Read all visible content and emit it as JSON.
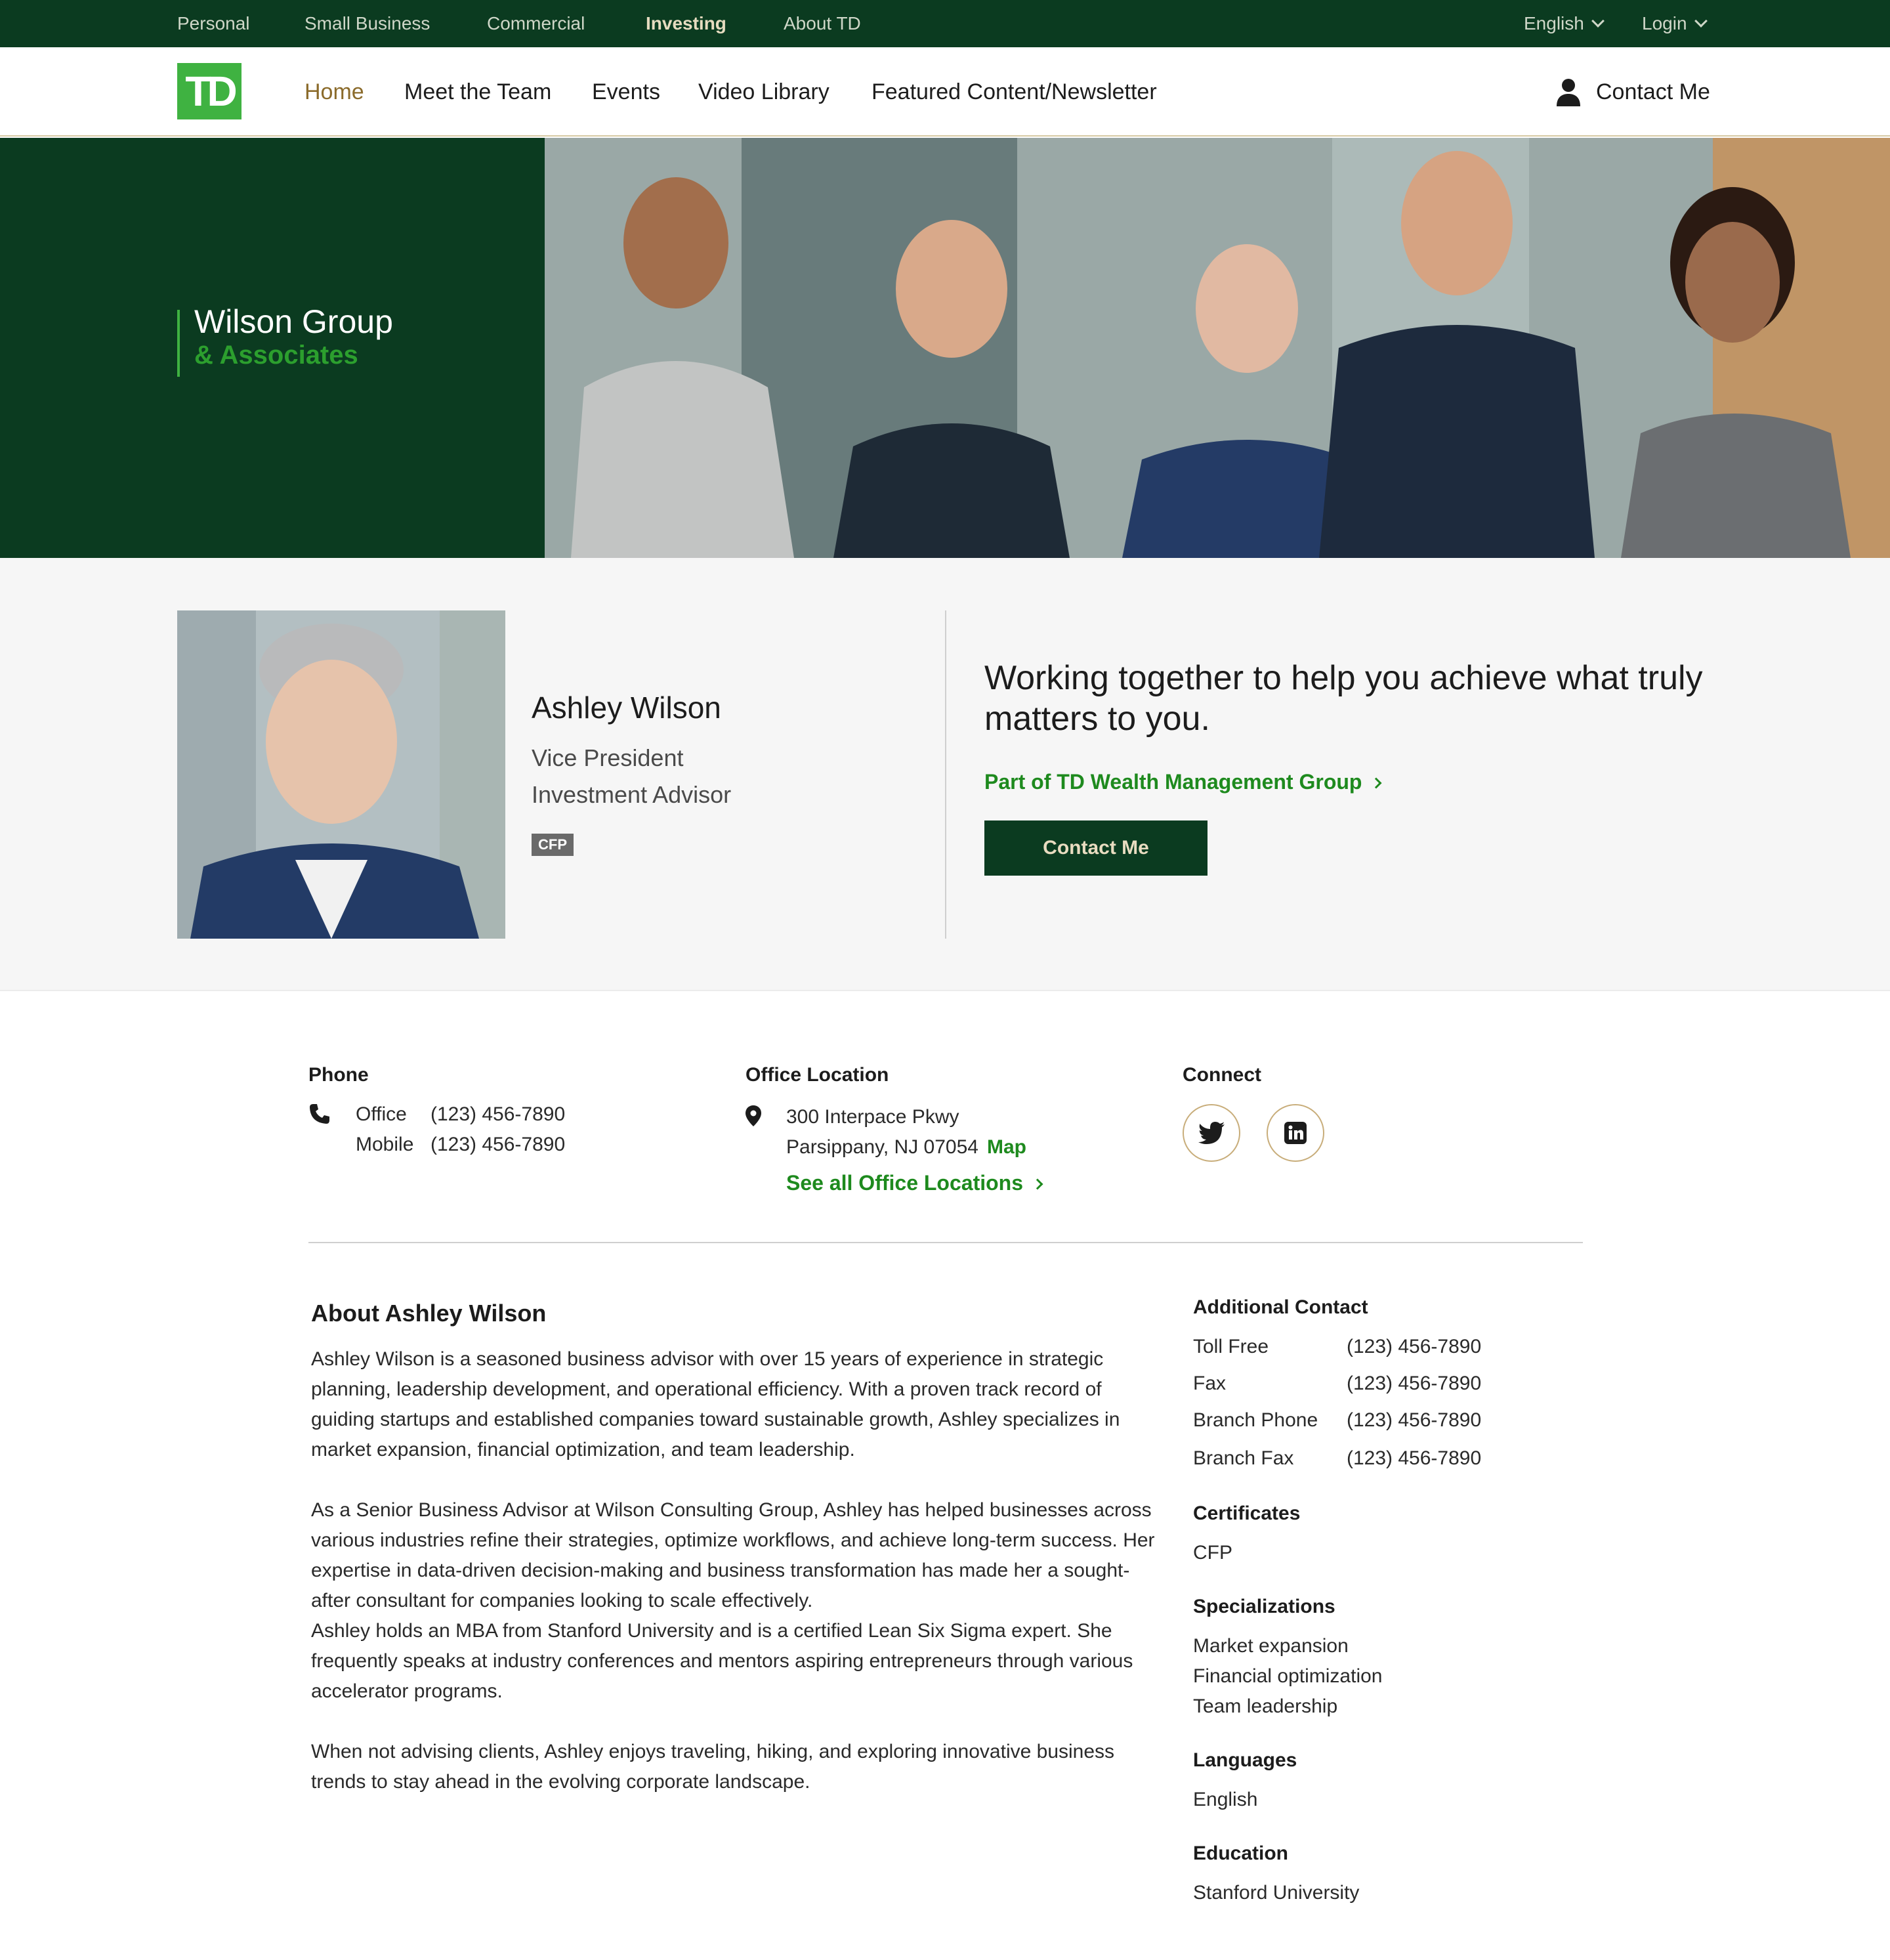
{
  "topbar": {
    "links": [
      "Personal",
      "Small Business",
      "Commercial",
      "Investing",
      "About TD"
    ],
    "active": "Investing",
    "language": "English",
    "login": "Login"
  },
  "nav": {
    "logo_text": "TD",
    "items": [
      "Home",
      "Meet the Team",
      "Events",
      "Video Library",
      "Featured Content/Newsletter"
    ],
    "active": "Home",
    "contact": "Contact Me"
  },
  "hero": {
    "title": "Wilson Group",
    "subtitle": "& Associates"
  },
  "profile": {
    "name": "Ashley Wilson",
    "title1": "Vice President",
    "title2": "Investment Advisor",
    "badge": "CFP",
    "tagline": "Working together to help you achieve what truly matters to you.",
    "group_link": "Part of TD Wealth Management Group",
    "contact_button": "Contact Me"
  },
  "phone": {
    "heading": "Phone",
    "office_label": "Office",
    "office": "(123) 456-7890",
    "mobile_label": "Mobile",
    "mobile": "(123) 456-7890"
  },
  "office": {
    "heading": "Office Location",
    "address1": "300 Interpace Pkwy",
    "address2": "Parsippany, NJ 07054",
    "map_link": "Map",
    "all_locations": "See all Office Locations"
  },
  "connect": {
    "heading": "Connect"
  },
  "about": {
    "title": "About Ashley Wilson",
    "p1": "Ashley Wilson is a seasoned business advisor with over 15 years of experience in strategic planning, leadership development, and operational efficiency. With a proven track record of guiding startups and established companies toward sustainable growth, Ashley specializes in market expansion, financial optimization, and team leadership.",
    "p2": "As a Senior Business Advisor at Wilson Consulting Group, Ashley has helped businesses across various industries refine their strategies, optimize workflows, and achieve long-term success. Her expertise in data-driven decision-making and business transformation has made her a sought-after consultant for companies looking to scale effectively.",
    "p3": "Ashley holds an MBA from Stanford University and is a certified Lean Six Sigma expert. She frequently speaks at industry conferences and mentors aspiring entrepreneurs through various accelerator programs.",
    "p4": "When not advising clients, Ashley enjoys traveling, hiking, and exploring innovative business trends to stay ahead in the evolving corporate landscape."
  },
  "additional": {
    "heading": "Additional Contact",
    "rows": [
      {
        "label": "Toll Free",
        "value": "(123) 456-7890"
      },
      {
        "label": "Fax",
        "value": "(123) 456-7890"
      },
      {
        "label": "Branch Phone",
        "value": "(123) 456-7890"
      },
      {
        "label": "Branch Fax",
        "value": "(123) 456-7890"
      }
    ],
    "certificates_heading": "Certificates",
    "certificates": "CFP",
    "specializations_heading": "Specializations",
    "specializations": [
      "Market expansion",
      "Financial optimization",
      "Team leadership"
    ],
    "languages_heading": "Languages",
    "languages": "English",
    "education_heading": "Education",
    "education": "Stanford University"
  },
  "colors": {
    "brand_dark_green": "#0b3b20",
    "brand_green": "#3fb241",
    "link_green": "#1e8a1e",
    "accent_gold": "#8b6b2b"
  }
}
